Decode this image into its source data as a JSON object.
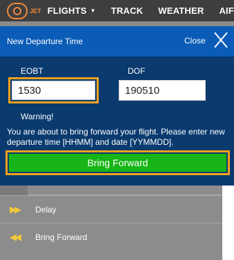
{
  "topnav": {
    "logo_text": "JET",
    "items": [
      {
        "label": "FLIGHTS",
        "caret": "▼"
      },
      {
        "label": "TRACK"
      },
      {
        "label": "WEATHER"
      },
      {
        "label": "AIF"
      }
    ]
  },
  "modal": {
    "title": "New Departure Time",
    "close_label": "Close",
    "eobt_label": "EOBT",
    "eobt_value": "1530",
    "dof_label": "DOF",
    "dof_value": "190510",
    "warning": "Warning!",
    "message": "You are about to bring forward your flight. Please enter new departure time [HHMM] and date [YYMMDD].",
    "button_label": "Bring Forward"
  },
  "menu": {
    "items": [
      {
        "label": "Delay",
        "icon": "fast-forward-icon"
      },
      {
        "label": "Bring Forward",
        "icon": "rewind-icon"
      }
    ]
  },
  "colors": {
    "modal_header": "#0a5cb7",
    "modal_body": "#0a3a6e",
    "highlight": "#f4a11d",
    "button_green": "#17b517",
    "logo_orange": "#f08a3c"
  }
}
